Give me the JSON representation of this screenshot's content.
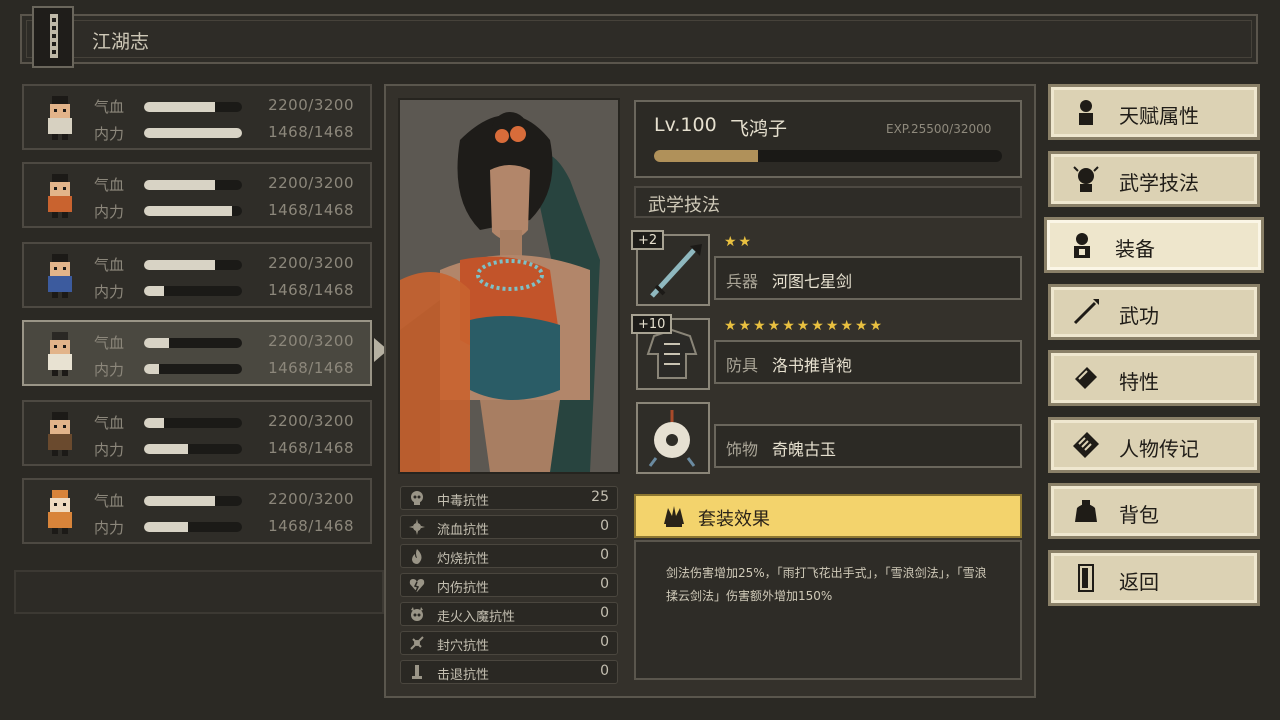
{
  "header": {
    "title": "江湖志"
  },
  "characters": [
    {
      "hp_label": "气血",
      "hp": "2200/3200",
      "hp_fill": 0.72,
      "mp_label": "内力",
      "mp": "1468/1468",
      "mp_fill": 1.0,
      "active": false
    },
    {
      "hp_label": "气血",
      "hp": "2200/3200",
      "hp_fill": 0.72,
      "mp_label": "内力",
      "mp": "1468/1468",
      "mp_fill": 0.9,
      "active": false
    },
    {
      "hp_label": "气血",
      "hp": "2200/3200",
      "hp_fill": 0.72,
      "mp_label": "内力",
      "mp": "1468/1468",
      "mp_fill": 0.2,
      "active": false
    },
    {
      "hp_label": "气血",
      "hp": "2200/3200",
      "hp_fill": 0.25,
      "mp_label": "内力",
      "mp": "1468/1468",
      "mp_fill": 0.15,
      "active": true
    },
    {
      "hp_label": "气血",
      "hp": "2200/3200",
      "hp_fill": 0.2,
      "mp_label": "内力",
      "mp": "1468/1468",
      "mp_fill": 0.45,
      "active": false
    },
    {
      "hp_label": "气血",
      "hp": "2200/3200",
      "hp_fill": 0.72,
      "mp_label": "内力",
      "mp": "1468/1468",
      "mp_fill": 0.45,
      "active": false
    }
  ],
  "profile": {
    "level": "Lv.100",
    "name": "飞鸿子",
    "exp": "EXP.25500/32000",
    "exp_fill": 0.3,
    "skills_title": "武学技法"
  },
  "resistances": [
    {
      "name": "中毒抗性",
      "value": "25",
      "icon": "skull-icon"
    },
    {
      "name": "流血抗性",
      "value": "0",
      "icon": "blood-icon"
    },
    {
      "name": "灼烧抗性",
      "value": "0",
      "icon": "fire-icon"
    },
    {
      "name": "内伤抗性",
      "value": "0",
      "icon": "broken-heart-icon"
    },
    {
      "name": "走火入魔抗性",
      "value": "0",
      "icon": "demon-icon"
    },
    {
      "name": "封穴抗性",
      "value": "0",
      "icon": "seal-icon"
    },
    {
      "name": "击退抗性",
      "value": "0",
      "icon": "knockback-icon"
    }
  ],
  "equipment": [
    {
      "plus": "+2",
      "stars": "★★",
      "type": "兵器",
      "name": "河图七星剑",
      "icon": "sword-icon"
    },
    {
      "plus": "+10",
      "stars": "★★★★★★★★★★★",
      "type": "防具",
      "name": "洛书推背袍",
      "icon": "robe-icon"
    },
    {
      "plus": "",
      "stars": "",
      "type": "饰物",
      "name": "奇魄古玉",
      "icon": "jade-icon"
    }
  ],
  "set_effect": {
    "title": "套装效果",
    "description": "剑法伤害增加25%，「雨打飞花出手式」，「雪浪剑法」，「雪浪揉云剑法」伤害额外增加150%"
  },
  "menu": [
    {
      "label": "天赋属性",
      "icon": "talent-icon",
      "selected": false
    },
    {
      "label": "武学技法",
      "icon": "martial-icon",
      "selected": false
    },
    {
      "label": "装备",
      "icon": "equipment-icon",
      "selected": true
    },
    {
      "label": "武功",
      "icon": "sword-icon",
      "selected": false
    },
    {
      "label": "特性",
      "icon": "trait-icon",
      "selected": false
    },
    {
      "label": "人物传记",
      "icon": "biography-icon",
      "selected": false
    },
    {
      "label": "背包",
      "icon": "bag-icon",
      "selected": false
    },
    {
      "label": "返回",
      "icon": "door-icon",
      "selected": false
    }
  ]
}
